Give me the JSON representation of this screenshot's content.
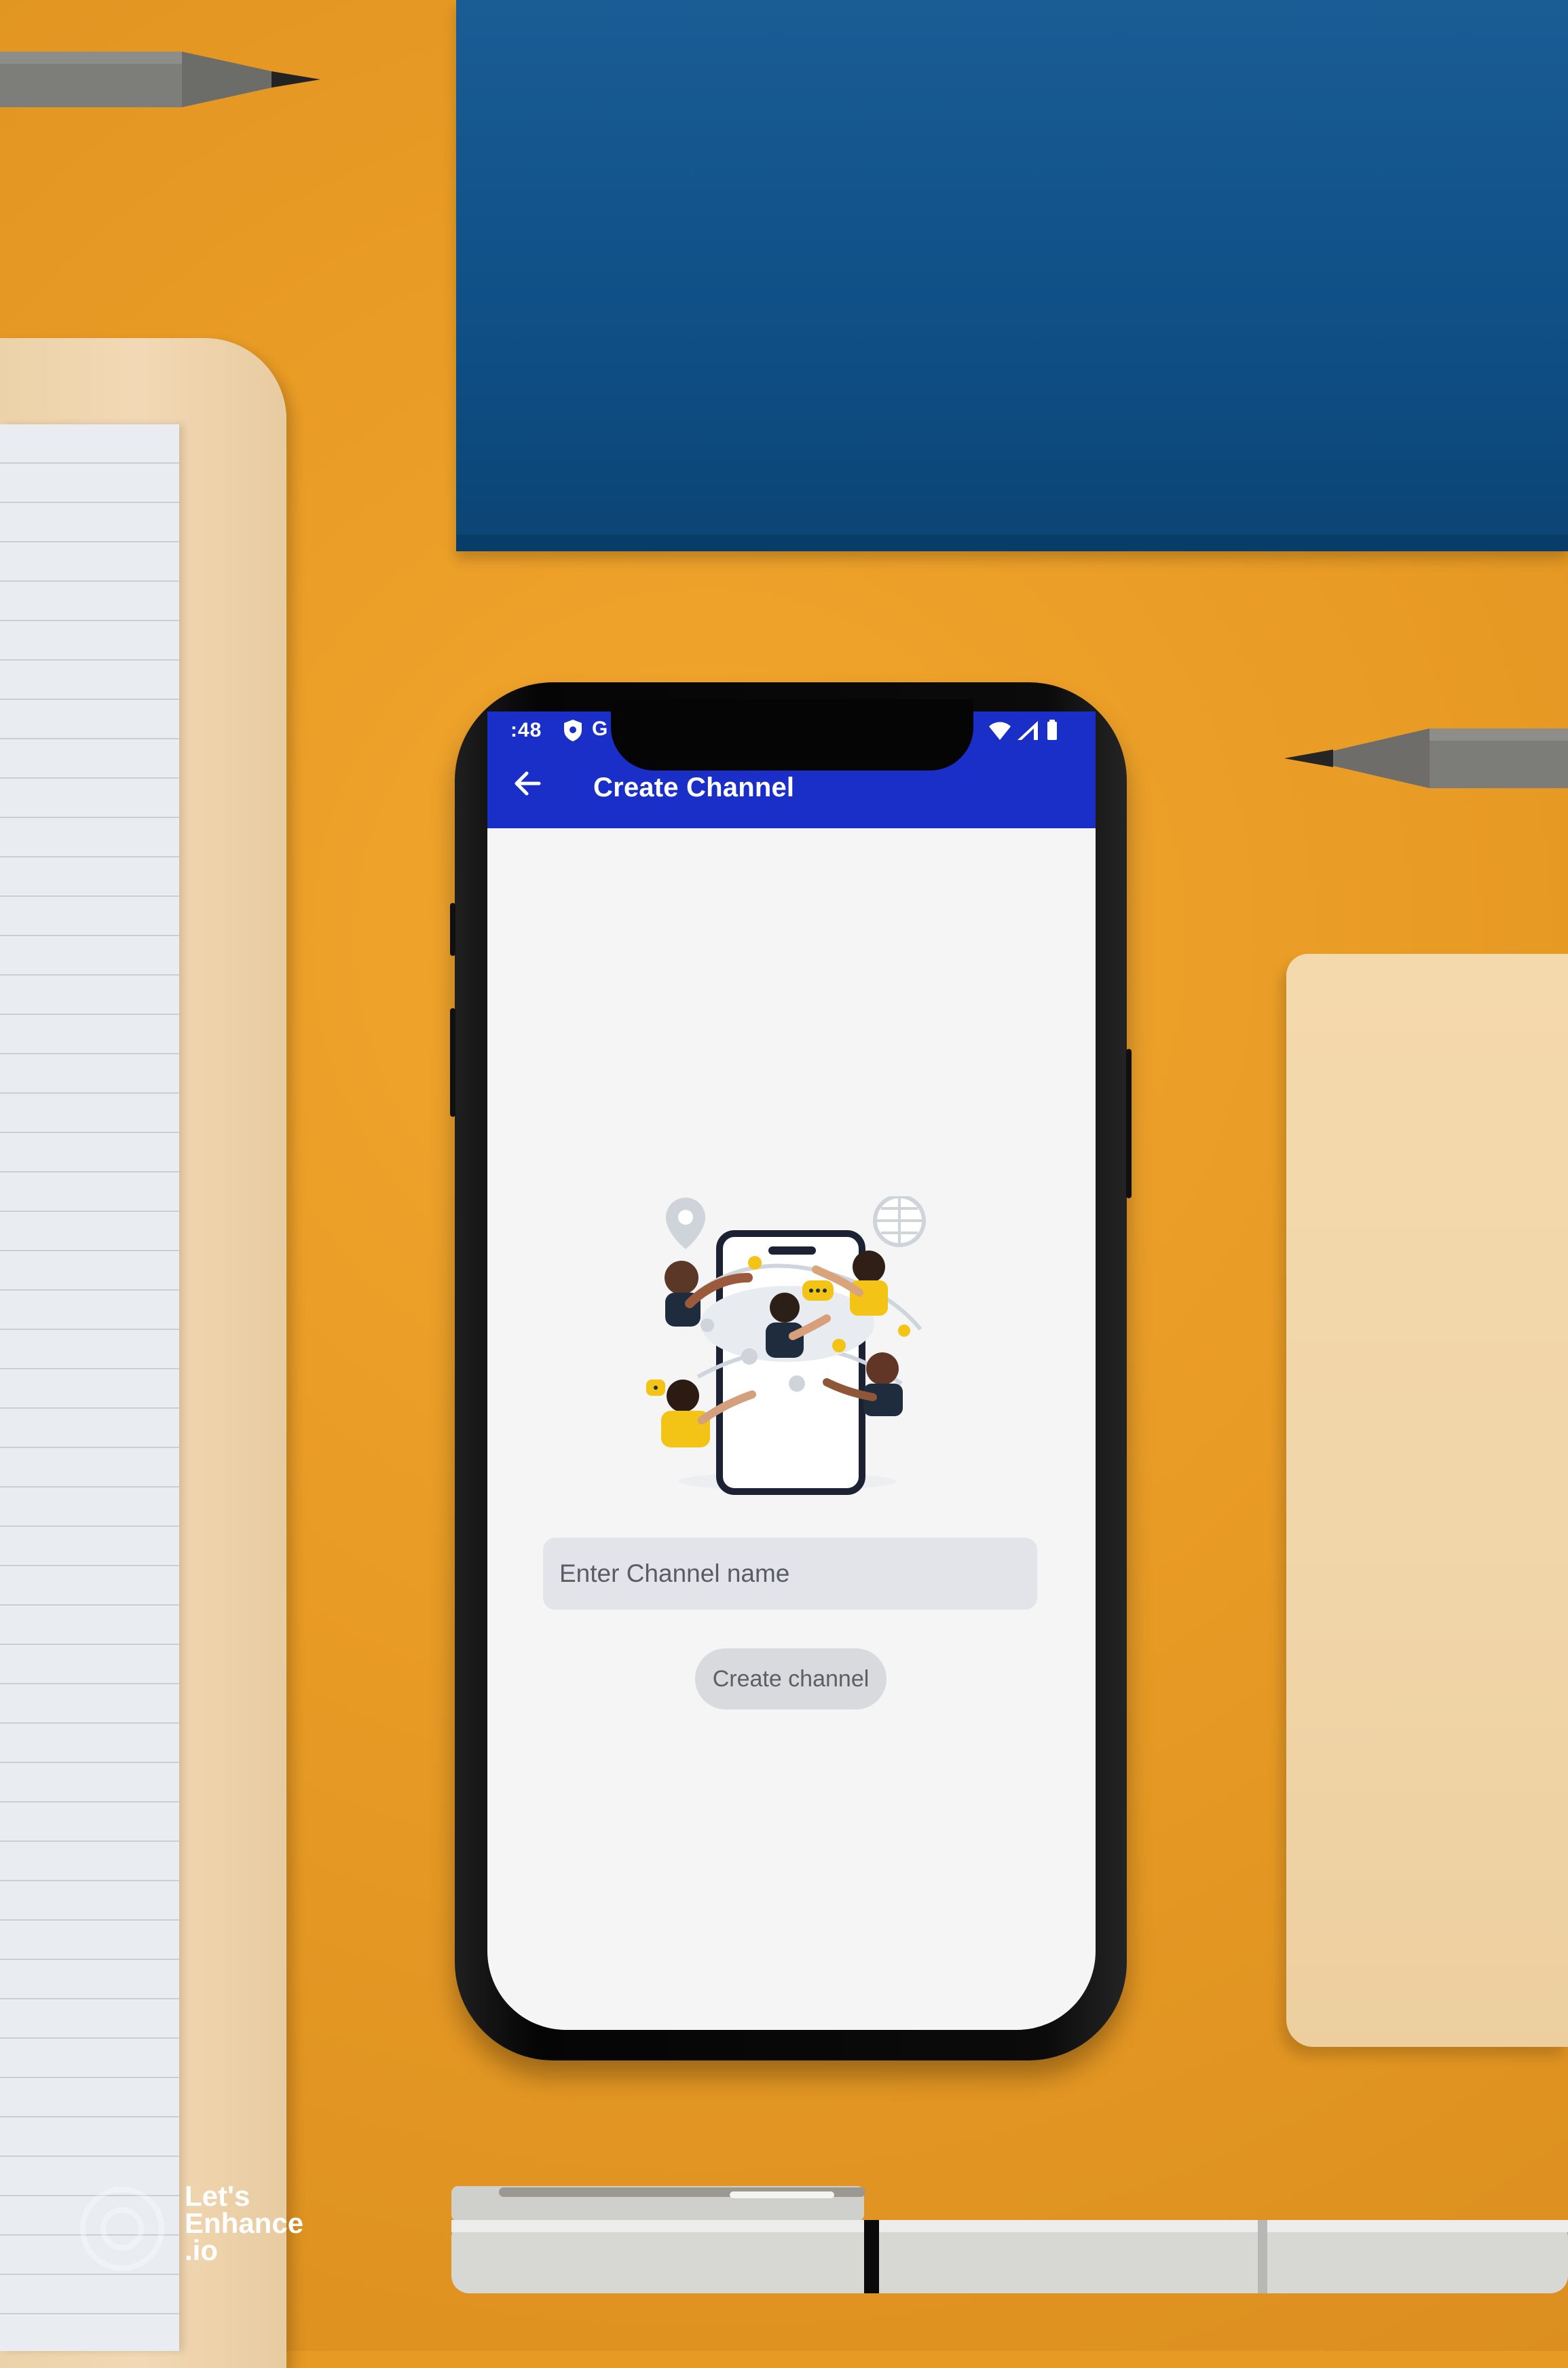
{
  "status_bar": {
    "time": ":48",
    "notification_glyph": "G",
    "icons": [
      "shield-icon",
      "wifi-icon",
      "signal-icon",
      "battery-icon"
    ]
  },
  "app_bar": {
    "title": "Create Channel",
    "back_icon": "back-arrow-icon",
    "color": "#1a2fc7"
  },
  "form": {
    "channel_name": {
      "placeholder": "Enter Channel name",
      "value": ""
    },
    "create_button_label": "Create channel"
  },
  "illustration": {
    "name": "channel-illustration"
  },
  "watermark": {
    "text": "Let's Enhance .io"
  },
  "colors": {
    "app_bar": "#1a2fc7",
    "screen_background": "#f5f5f5",
    "input_background": "#e2e4ea",
    "button_background": "#d9dade",
    "desk": "#e79a24"
  }
}
